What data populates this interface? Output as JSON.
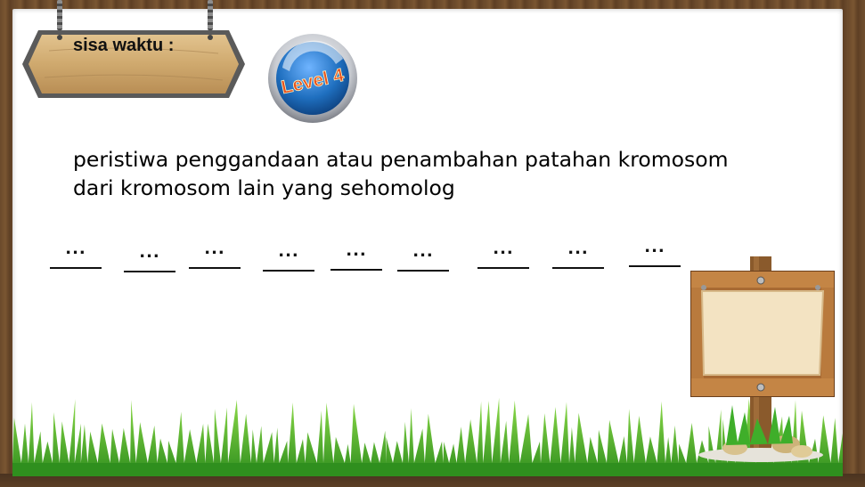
{
  "timer": {
    "label": "sisa waktu :"
  },
  "level_badge": {
    "text": "Level 4"
  },
  "question": {
    "line1": "peristiwa penggandaan atau penambahan patahan kromosom",
    "line2": "dari kromosom lain yang sehomolog"
  },
  "answer_blanks": [
    "...",
    "...",
    "...",
    "...",
    "...",
    "...",
    "...",
    "...",
    "..."
  ],
  "colors": {
    "wood": "#c9a46a",
    "wood_dark": "#6b4a2b",
    "badge_blue": "#1f6fbf",
    "badge_text": "#e8501c",
    "grass": "#3fae2a"
  }
}
